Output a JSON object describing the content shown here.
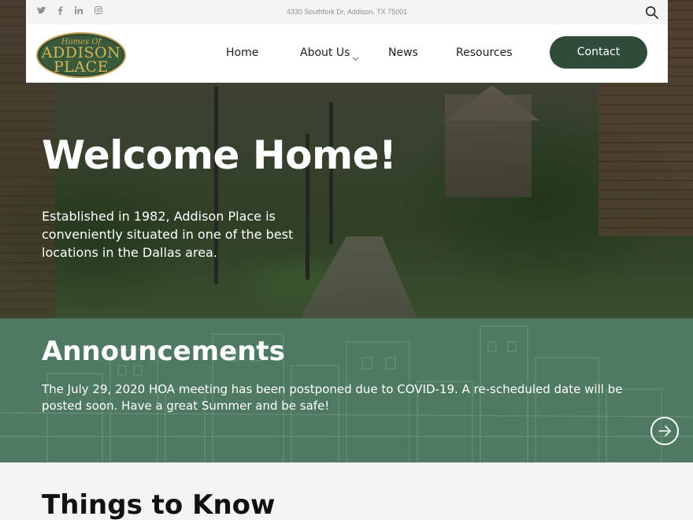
{
  "topbar": {
    "address": "4330 Southfork Dr, Addison, TX 75001",
    "social_icons": [
      "twitter-icon",
      "facebook-icon",
      "linkedin-icon",
      "instagram-icon"
    ]
  },
  "logo": {
    "line1": "Homes Of",
    "line2": "ADDISON",
    "line3": "PLACE"
  },
  "nav": {
    "items": [
      {
        "label": "Home"
      },
      {
        "label": "About Us"
      },
      {
        "label": "News"
      },
      {
        "label": "Resources"
      }
    ],
    "contact_label": "Contact"
  },
  "hero": {
    "title": "Welcome Home!",
    "text": "Established in 1982, Addison Place is conveniently situated in one of the best locations in the Dallas area."
  },
  "announcements": {
    "title": "Announcements",
    "text": "The July 29, 2020 HOA meeting has been postponed due to COVID-19. A re-scheduled date will be posted soon. Have a great Summer and be safe!"
  },
  "things_to_know": {
    "title": "Things to Know"
  },
  "colors": {
    "brand_green": "#2f4c3b",
    "announce_green": "#4e7a61",
    "logo_gold": "#caa74f"
  }
}
